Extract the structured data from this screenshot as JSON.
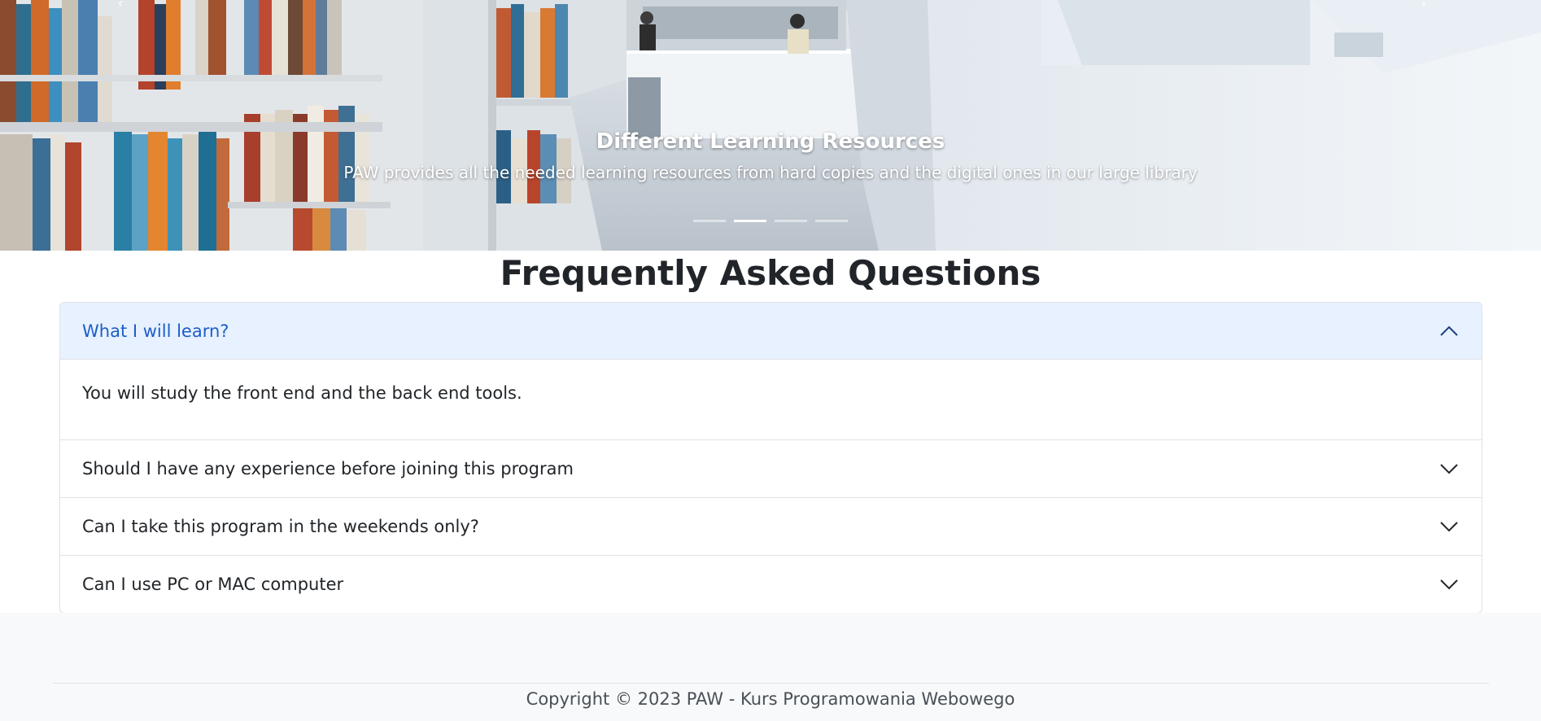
{
  "carousel": {
    "slide_title": "Different Learning Resources",
    "slide_text": "PAW provides all the needed learning resources from hard copies and the digital ones in our large library",
    "indicator_count": 4,
    "active_indicator": 2
  },
  "faq": {
    "heading": "Frequently Asked Questions",
    "items": [
      {
        "question": "What I will learn?",
        "answer": "You will study the front end and the back end tools.",
        "expanded": true
      },
      {
        "question": "Should I have any experience before joining this program",
        "expanded": false
      },
      {
        "question": "Can I take this program in the weekends only?",
        "expanded": false
      },
      {
        "question": "Can I use PC or MAC computer",
        "expanded": false
      }
    ]
  },
  "footer": {
    "copyright": "Copyright © 2023 PAW - Kurs Programowania Webowego"
  },
  "colors": {
    "accordion_active_bg": "#e7f1ff",
    "accordion_active_text": "#1c5ec9",
    "footer_bg": "#f8f9fa"
  },
  "icons": {
    "expanded": "chevron-up-icon",
    "collapsed": "chevron-down-icon"
  }
}
